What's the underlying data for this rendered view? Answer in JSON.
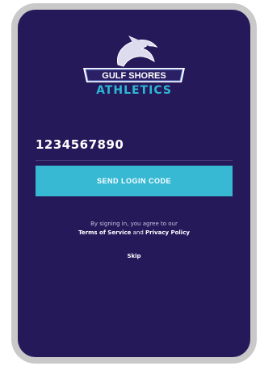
{
  "brand": {
    "logo_text": "GULF SHORES",
    "subtitle": "ATHLETICS"
  },
  "login": {
    "phone_value": "1234567890",
    "send_button_label": "SEND LOGIN CODE"
  },
  "legal": {
    "prefix": "By signing in, you agree to our",
    "terms_label": "Terms of Service",
    "conjunction": "and",
    "privacy_label": "Privacy Policy"
  },
  "skip_label": "Skip",
  "colors": {
    "background": "#25195a",
    "accent": "#38b9d3",
    "frame": "#c9c9c9"
  }
}
